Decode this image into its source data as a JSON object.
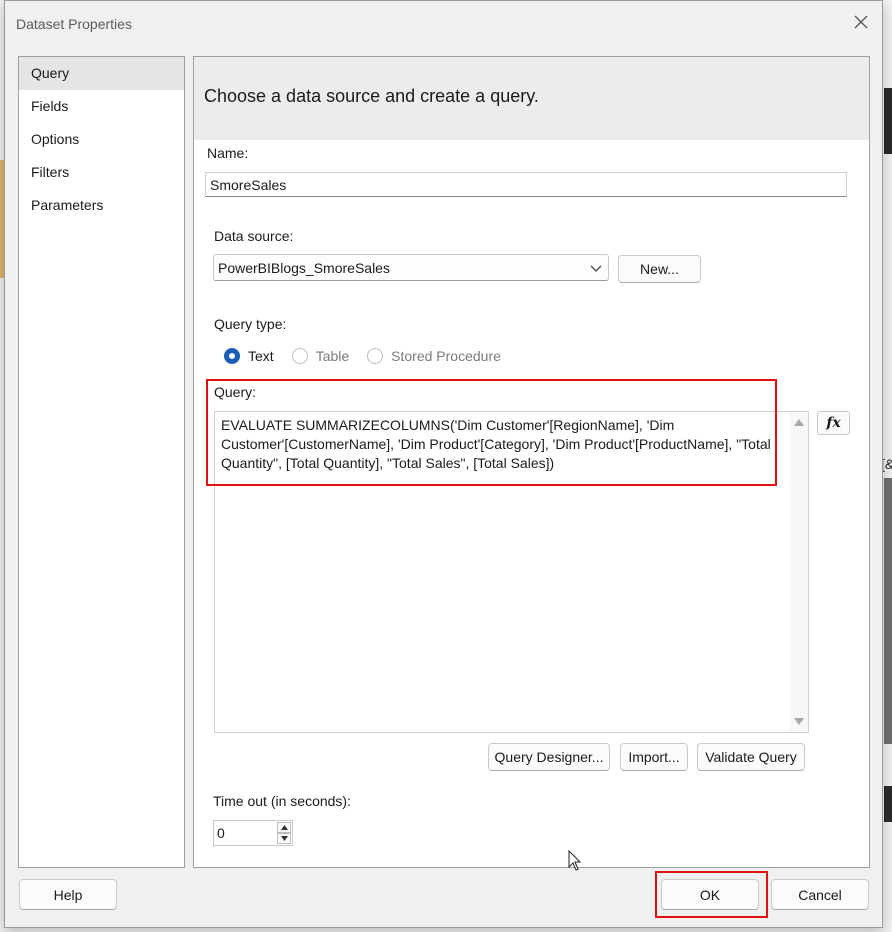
{
  "window": {
    "title": "Dataset Properties",
    "close_icon": "close-icon"
  },
  "nav": {
    "items": [
      {
        "label": "Query",
        "selected": true
      },
      {
        "label": "Fields"
      },
      {
        "label": "Options"
      },
      {
        "label": "Filters"
      },
      {
        "label": "Parameters"
      }
    ]
  },
  "page": {
    "heading": "Choose a data source and create a query.",
    "name_label": "Name:",
    "name_value": "SmoreSales",
    "datasource_label": "Data source:",
    "datasource_value": "PowerBIBlogs_SmoreSales",
    "new_button": "New...",
    "query_type_label": "Query type:",
    "query_types": [
      {
        "label": "Text",
        "selected": true
      },
      {
        "label": "Table"
      },
      {
        "label": "Stored Procedure"
      }
    ],
    "query_label": "Query:",
    "query_text": "EVALUATE SUMMARIZECOLUMNS('Dim Customer'[RegionName], 'Dim\nCustomer'[CustomerName], 'Dim Product'[Category], 'Dim Product'[ProductName], \"Total\nQuantity\", [Total Quantity], \"Total Sales\", [Total Sales])",
    "fx_button": "fx",
    "query_designer_button": "Query Designer...",
    "import_button": "Import...",
    "validate_button": "Validate Query",
    "timeout_label": "Time out (in seconds):",
    "timeout_value": "0"
  },
  "footer": {
    "help": "Help",
    "ok": "OK",
    "cancel": "Cancel"
  },
  "background": {
    "right_text": "[&"
  },
  "colors": {
    "accent": "#1a5fb4",
    "highlight": "#e01010"
  }
}
